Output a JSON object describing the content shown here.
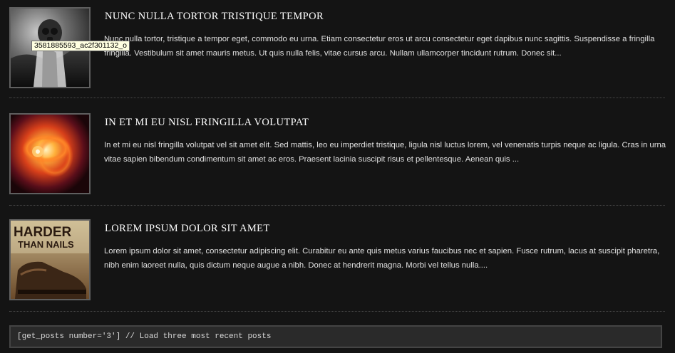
{
  "posts": [
    {
      "title": "Nunc nulla tortor tristique tempor",
      "excerpt": "Nunc nulla tortor, tristique a tempor eget, commodo eu urna. Etiam consectetur eros ut arcu consectetur eget dapibus nunc sagittis. Suspendisse a fringilla fringilla. Vestibulum sit amet mauris metus. Ut quis nulla felis, vitae cursus arcu. Nullam ullamcorper tincidunt rutrum. Donec sit...",
      "thumbnail_tooltip": "3581885593_ac2f301132_o"
    },
    {
      "title": "In et mi eu nisl fringilla volutpat",
      "excerpt": "In et mi eu nisl fringilla volutpat vel sit amet elit. Sed mattis, leo eu imperdiet tristique, ligula nisl luctus lorem, vel venenatis turpis neque ac ligula. Cras in urna vitae sapien bibendum condimentum sit amet ac eros. Praesent lacinia suscipit risus et pellentesque. Aenean quis ..."
    },
    {
      "title": "Lorem ipsum dolor sit amet",
      "excerpt": "Lorem ipsum dolor sit amet, consectetur adipiscing elit. Curabitur eu ante quis metus varius faucibus nec et sapien. Fusce rutrum, lacus at suscipit pharetra, nibh enim laoreet nulla, quis dictum neque augue a nibh. Donec at hendrerit magna. Morbi vel tellus nulla....",
      "thumbnail_text": [
        "HARDER",
        "THAN NAILS"
      ]
    }
  ],
  "code_snippet": "[get_posts number='3'] // Load three most recent posts"
}
